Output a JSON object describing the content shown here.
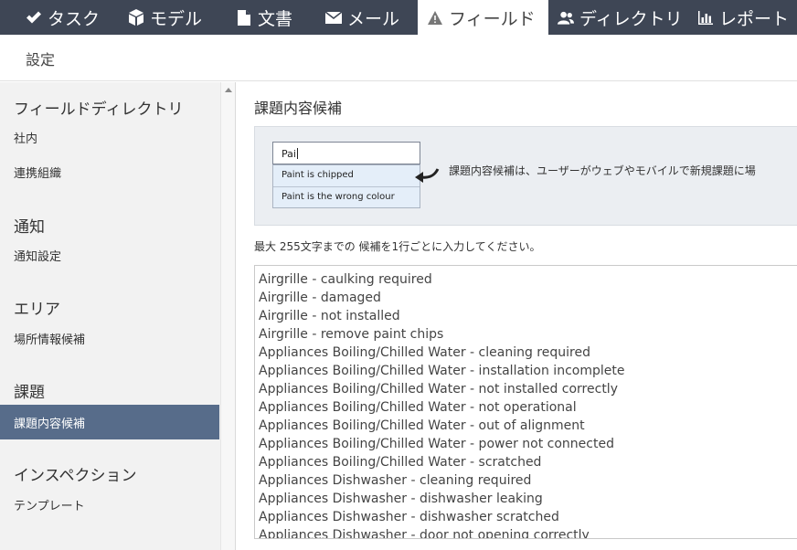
{
  "nav": {
    "tabs": [
      {
        "label": "タスク",
        "icon": "check-icon",
        "active": false
      },
      {
        "label": "モデル",
        "icon": "cube-icon",
        "active": false
      },
      {
        "label": "文書",
        "icon": "file-icon",
        "active": false
      },
      {
        "label": "メール",
        "icon": "envelope-icon",
        "active": false
      },
      {
        "label": "フィールド",
        "icon": "warning-icon",
        "active": true
      },
      {
        "label": "ディレクトリ",
        "icon": "users-icon",
        "active": false
      },
      {
        "label": "レポート",
        "icon": "bar-chart-icon",
        "active": false
      }
    ]
  },
  "subheader": {
    "label": "設定"
  },
  "sidebar": {
    "sections": [
      {
        "heading": "フィールドディレクトリ",
        "items": [
          "社内",
          "連携組織"
        ]
      },
      {
        "heading": "通知",
        "items": [
          "通知設定"
        ]
      },
      {
        "heading": "エリア",
        "items": [
          "場所情報候補"
        ]
      },
      {
        "heading": "課題",
        "items": [
          "課題内容候補"
        ]
      },
      {
        "heading": "インスペクション",
        "items": [
          "テンプレート"
        ]
      }
    ],
    "active_item": "課題内容候補"
  },
  "main": {
    "title": "課題内容候補",
    "demo": {
      "input_value": "Pai",
      "suggestions": [
        "Paint is chipped",
        "Paint is the wrong colour"
      ],
      "description": "課題内容候補は、ユーザーがウェブやモバイルで新規課題に場"
    },
    "hint": "最大 255文字までの 候補を1行ごとに入力してください。",
    "lines": [
      "Airgrille - caulking required",
      "Airgrille - damaged",
      "Airgrille - not installed",
      "Airgrille - remove paint chips",
      "Appliances Boiling/Chilled Water - cleaning required",
      "Appliances Boiling/Chilled Water - installation incomplete",
      "Appliances Boiling/Chilled Water - not installed correctly",
      "Appliances Boiling/Chilled Water - not operational",
      "Appliances Boiling/Chilled Water - out of alignment",
      "Appliances Boiling/Chilled Water - power not connected",
      "Appliances Boiling/Chilled Water - scratched",
      "Appliances Dishwasher - cleaning required",
      "Appliances Dishwasher - dishwasher leaking",
      "Appliances Dishwasher - dishwasher scratched",
      "Appliances Dishwasher - door not opening correctly"
    ]
  },
  "colors": {
    "nav_bg": "#3e4655",
    "active_sidebar": "#576c8a",
    "info_box_bg": "#ebeef2"
  }
}
